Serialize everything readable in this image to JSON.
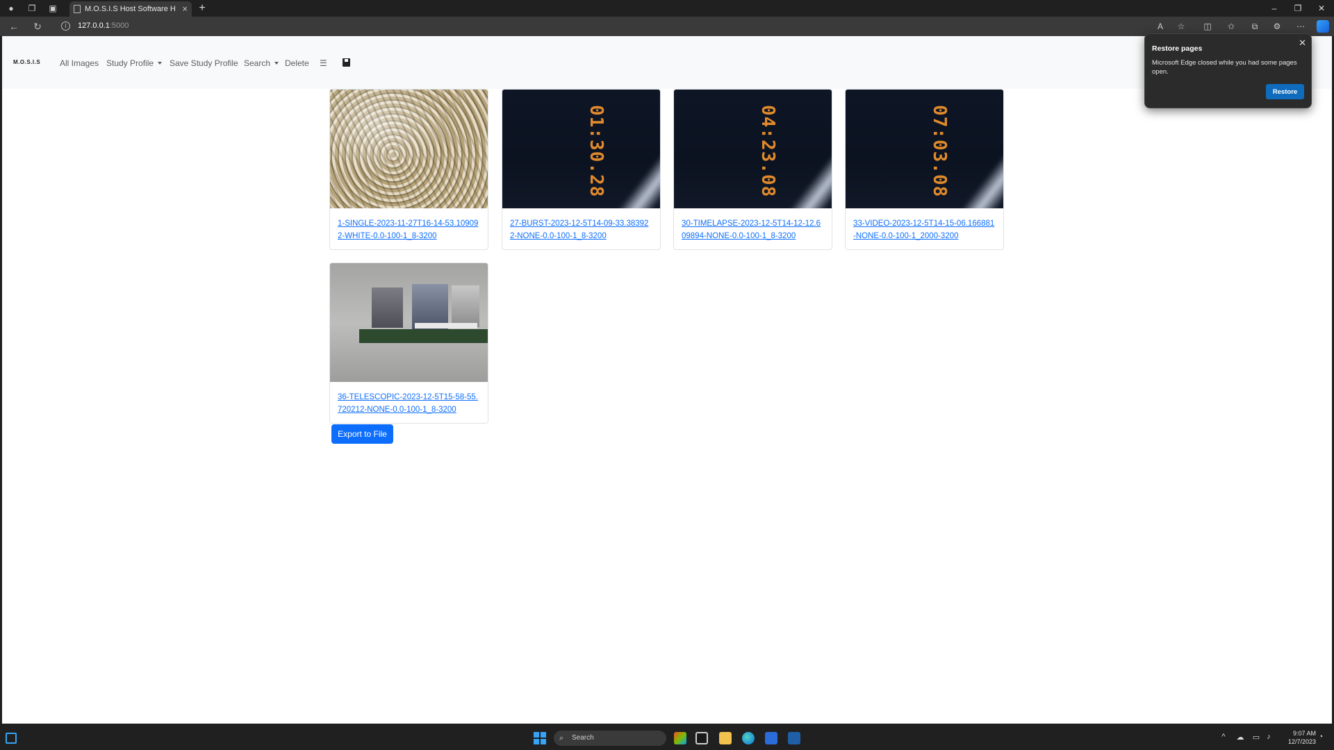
{
  "browser": {
    "tab_title": "M.O.S.I.S Host Software Home Pa",
    "url_host": "127.0.0.1",
    "url_port": ":5000"
  },
  "navbar": {
    "brand": "M.O.S.I.S",
    "links": {
      "all_images": "All Images",
      "study_profile": "Study Profile",
      "save_study_profile": "Save Study Profile",
      "search": "Search",
      "delete": "Delete"
    }
  },
  "images": [
    {
      "name": "1-SINGLE-2023-11-27T16-14-53.109092-WHITE-0.0-100-1_8-3200"
    },
    {
      "name": "27-BURST-2023-12-5T14-09-33.383922-NONE-0.0-100-1_8-3200",
      "overlay": "01:30.28"
    },
    {
      "name": "30-TIMELAPSE-2023-12-5T14-12-12.609894-NONE-0.0-100-1_8-3200",
      "overlay": "04:23.08"
    },
    {
      "name": "33-VIDEO-2023-12-5T14-15-06.166881-NONE-0.0-100-1_2000-3200",
      "overlay": "07:03.08"
    },
    {
      "name": "36-TELESCOPIC-2023-12-5T15-58-55.720212-NONE-0.0-100-1_8-3200"
    }
  ],
  "export_button": "Export to File",
  "popup": {
    "title": "Restore pages",
    "message": "Microsoft Edge closed while you had some pages open.",
    "button": "Restore"
  },
  "taskbar": {
    "search_placeholder": "Search",
    "time": "9:07 AM",
    "date": "12/7/2023"
  },
  "colors": {
    "accent": "#0d6efd",
    "link": "#0d6efd",
    "popup_button": "#0f6cbd"
  }
}
